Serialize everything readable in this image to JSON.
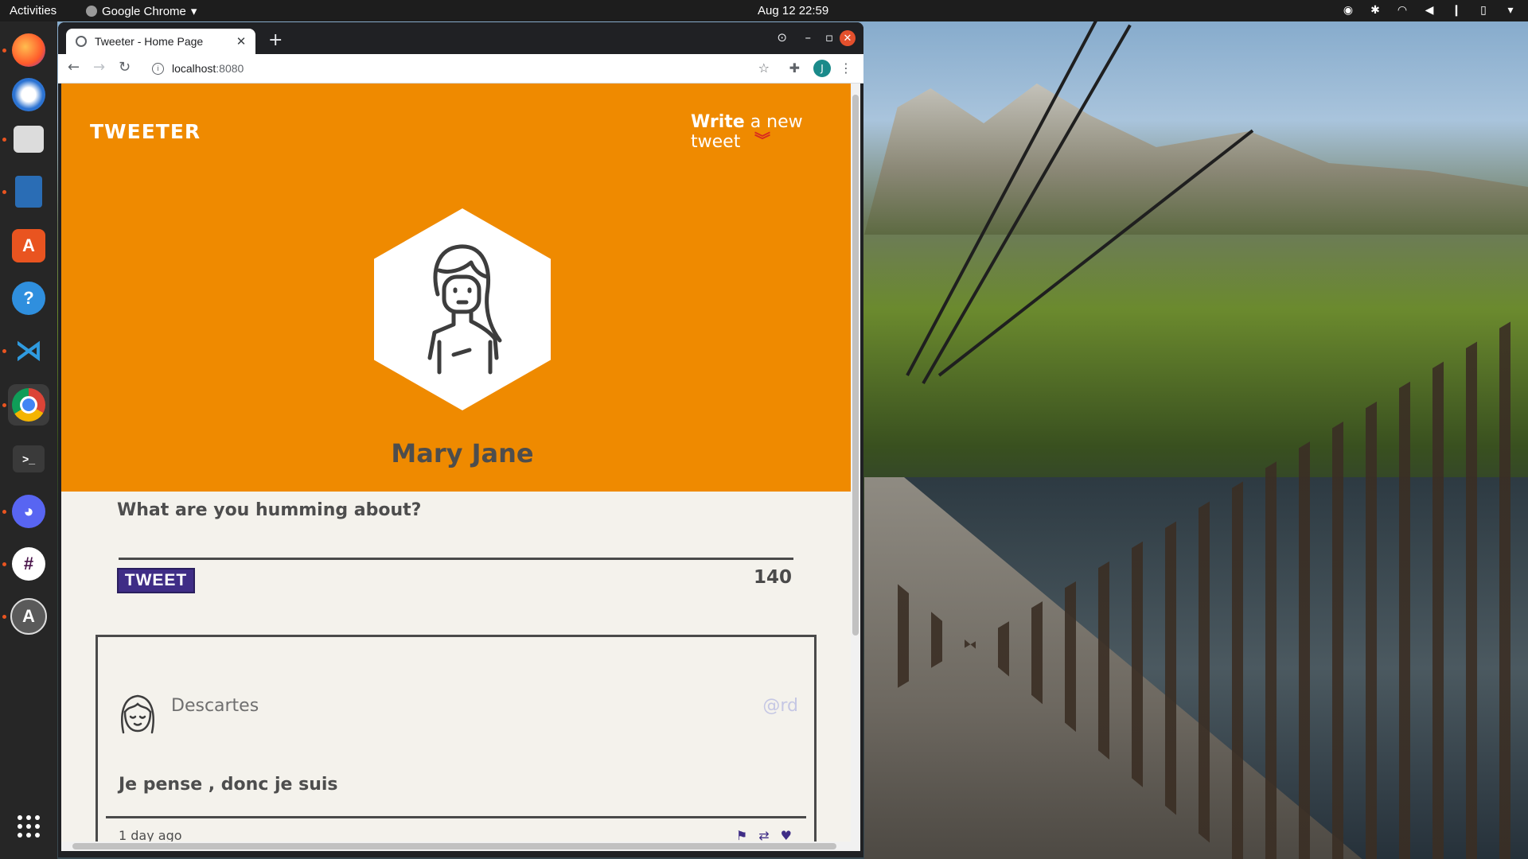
{
  "system": {
    "activities": "Activities",
    "app_menu": "Google Chrome",
    "clock": "Aug 12  22:59"
  },
  "browser": {
    "tab_title": "Tweeter - Home Page",
    "url_host": "localhost",
    "url_port": ":8080",
    "profile_initial": "J"
  },
  "page": {
    "brand": "TWEETER",
    "write_bold": "Write",
    "write_rest": " a new tweet",
    "user_name": "Mary Jane",
    "composer_label": "What are you humming about?",
    "tweet_button": "TWEET",
    "char_counter": "140",
    "tweet": {
      "author": "Descartes",
      "handle": "@rd",
      "text": "Je pense , donc je suis",
      "time": "1 day ago"
    }
  },
  "colors": {
    "hero": "#ef8a00",
    "button": "#3f2d86",
    "chevrons": "#d92b1f",
    "page_bg": "#f4f2ec"
  }
}
